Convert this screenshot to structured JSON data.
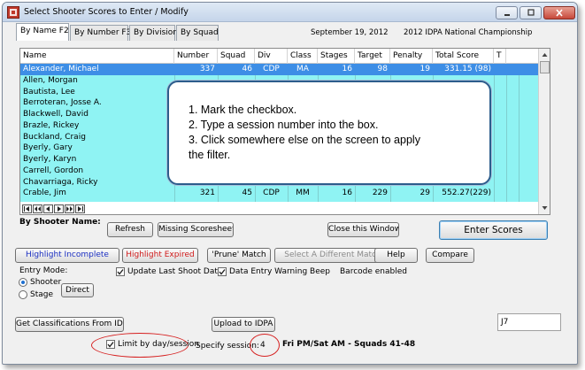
{
  "window": {
    "title": "Select Shooter Scores to Enter / Modify",
    "date": "September 19, 2012",
    "event": "2012 IDPA National Championship"
  },
  "tabs": [
    {
      "label": "By Name F2"
    },
    {
      "label": "By Number F3"
    },
    {
      "label": "By Division"
    },
    {
      "label": "By Squad"
    }
  ],
  "grid": {
    "columns": [
      "Name",
      "Number",
      "Squad",
      "Div",
      "Class",
      "Stages",
      "Target",
      "Penalty",
      "Total Score",
      "T"
    ],
    "rows": [
      {
        "name": "Alexander, Michael",
        "number": "337",
        "squad": "46",
        "div": "CDP",
        "class": "MA",
        "stages": "16",
        "target": "98",
        "penalty": "19",
        "total": "331.15 (98)",
        "selected": true
      },
      {
        "name": "Allen, Morgan"
      },
      {
        "name": "Bautista, Lee"
      },
      {
        "name": "Berroteran, Josse A."
      },
      {
        "name": "Blackwell, David"
      },
      {
        "name": "Brazle, Rickey"
      },
      {
        "name": "Buckland, Craig"
      },
      {
        "name": "Byerly, Gary"
      },
      {
        "name": "Byerly, Karyn"
      },
      {
        "name": "Carrell, Gordon"
      },
      {
        "name": "Chavarriaga, Ricky"
      },
      {
        "name": "Crable, Jim",
        "number": "321",
        "squad": "45",
        "div": "CDP",
        "class": "MM",
        "stages": "16",
        "target": "229",
        "penalty": "29",
        "total": "552.27(229)"
      }
    ]
  },
  "overlay": {
    "lines": [
      "1. Mark the checkbox.",
      "2. Type a session number into the box.",
      "3. Click somewhere else on the screen to apply",
      "the filter."
    ]
  },
  "actions": {
    "by_shooter_label": "By Shooter Name:",
    "refresh": "Refresh",
    "missing": "Missing Scoresheets",
    "close_window": "Close this Window",
    "enter_scores": "Enter Scores",
    "highlight_incomplete": "Highlight Incomplete",
    "highlight_expired": "Highlight Expired",
    "prune_match": "'Prune' Match",
    "select_different": "Select A Different  Match",
    "help": "Help",
    "compare": "Compare",
    "get_classifications": "Get Classifications From IDPA",
    "upload": "Upload to IDPA"
  },
  "entry_mode": {
    "label": "Entry Mode:",
    "shooter": "Shooter",
    "stage": "Stage",
    "direct": "Direct",
    "selected": "shooter"
  },
  "options": {
    "update_last_shoot_date": "Update Last Shoot Date",
    "data_entry_warning_beep": "Data Entry Warning Beep",
    "barcode": "Barcode enabled"
  },
  "filter": {
    "limit_label": "Limit by day/session",
    "specify_label": "Specify session:",
    "session_value": "4",
    "session_name": "Fri PM/Sat AM - Squads 41-48"
  },
  "field_j7": "J7",
  "colors": {
    "grid_bg": "#8ff3f3",
    "selected_row": "#3d8ee6",
    "highlight_incomplete": "#1b2fc2",
    "highlight_expired": "#d01a1a",
    "annotation": "#d62020"
  }
}
